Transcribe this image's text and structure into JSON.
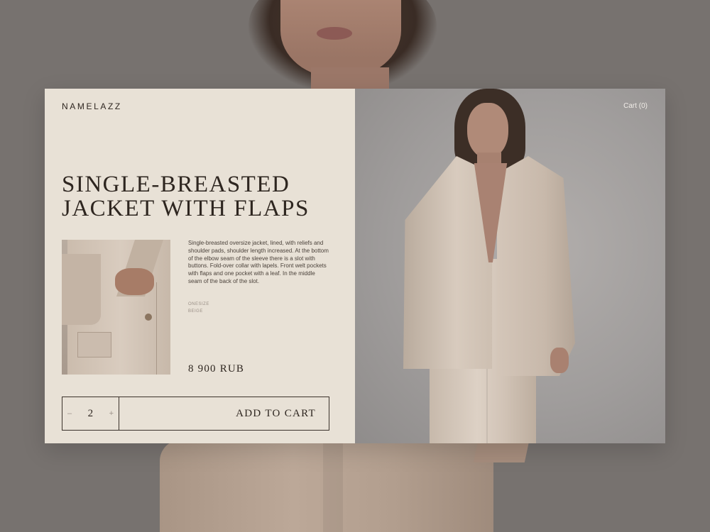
{
  "brand": {
    "logo": "NAMELAZZ"
  },
  "header": {
    "cart_label": "Cart (0)"
  },
  "product": {
    "title": "SINGLE-BREASTED JACKET WITH FLAPS",
    "description": "Single-breasted oversize jacket, lined, with reliefs and shoulder pads, shoulder length increased. At the bottom of the elbow seam of the sleeve there is a slot with buttons. Fold-over collar with lapels. Front welt pockets with flaps and one pocket with a leaf. In the middle seam of the back of the slot.",
    "size": "ONESIZE",
    "color": "BEIGE",
    "price": "8 900 RUB"
  },
  "purchase": {
    "decrement_label": "–",
    "quantity": "2",
    "increment_label": "+",
    "add_to_cart_label": "ADD TO CART"
  },
  "colors": {
    "panel": "#e8e1d6",
    "text": "#2e2620",
    "page_background": "#77726f"
  }
}
